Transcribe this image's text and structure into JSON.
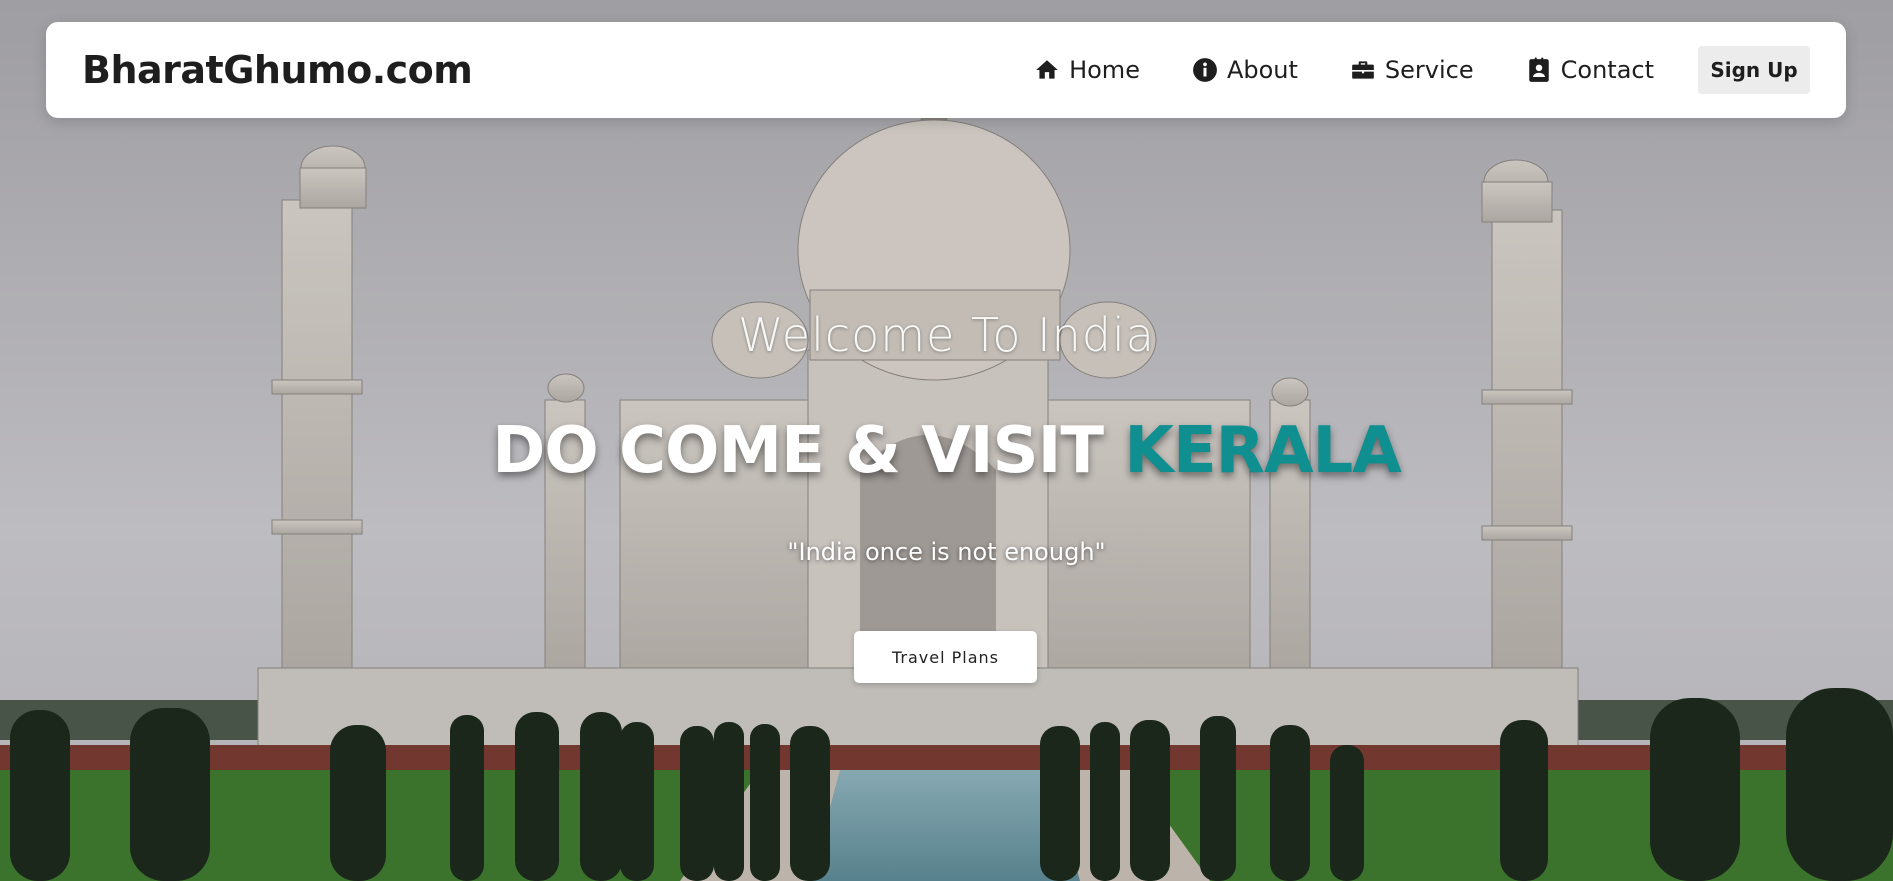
{
  "brand": {
    "name": "BharatGhumo.com"
  },
  "nav": {
    "items": [
      {
        "label": "Home",
        "icon": "home-icon"
      },
      {
        "label": "About",
        "icon": "info-icon"
      },
      {
        "label": "Service",
        "icon": "briefcase-icon"
      },
      {
        "label": "Contact",
        "icon": "contact-card-icon"
      }
    ],
    "signup_label": "Sign Up"
  },
  "hero": {
    "welcome": "Welcome To India",
    "headline_main": "DO COME & VISIT",
    "headline_accent": "KERALA",
    "tagline": "\"India once is not enough\"",
    "cta_label": "Travel Plans",
    "background_image": "taj-mahal-photo"
  },
  "colors": {
    "accent": "#0f8f8f",
    "navbar_bg": "#ffffff",
    "text_dark": "#1e1e1e",
    "signup_bg": "#ececec"
  }
}
